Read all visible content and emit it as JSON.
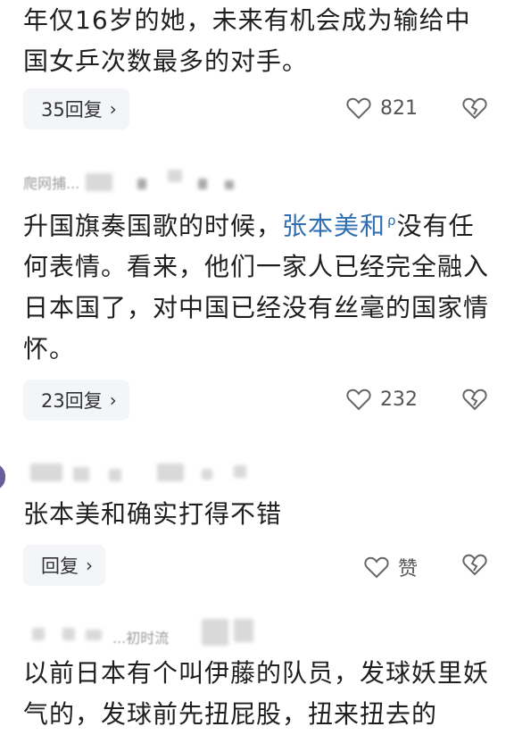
{
  "comments": [
    {
      "text": "年仅16岁的她，未来有机会成为输给中国女乒次数最多的对手。",
      "reply_label": "35回复",
      "likes": "821"
    },
    {
      "username": "爬网捕...",
      "text_before": "升国旗奏国歌的时候，",
      "mention": "张本美和",
      "text_after": "没有任何表情。看来，他们一家人已经完全融入日本国了，对中国已经没有丝毫的国家情怀。",
      "reply_label": "23回复",
      "likes": "232"
    },
    {
      "text": "张本美和确实打得不错",
      "reply_label": "回复",
      "likes": "赞"
    },
    {
      "username": "...初时流",
      "text": "以前日本有个叫伊藤的队员，发球妖里妖气的，发球前先扭屁股，扭来扭去的"
    }
  ],
  "icons": {
    "like": "heart-outline-icon",
    "dislike": "broken-heart-icon",
    "chevron": "chevron-right-icon",
    "mention": "search-icon"
  }
}
